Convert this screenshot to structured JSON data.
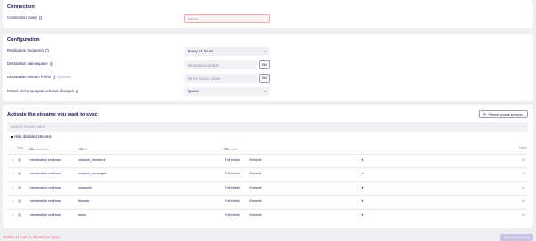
{
  "connection": {
    "section_title": "Connection",
    "name_label": "Connection name",
    "name_placeholder": "Name"
  },
  "configuration": {
    "section_title": "Configuration",
    "replication_label": "Replication frequency",
    "replication_value": "Every 24 hours",
    "namespace_label": "Destination Namespace",
    "namespace_value": "Destination default",
    "namespace_edit": "Edit",
    "prefix_label": "Destination Stream Prefix",
    "prefix_optional": "Optional",
    "prefix_placeholder": "Mirror source name",
    "prefix_edit": "Edit",
    "schema_changes_label": "Detect and propagate schema changes",
    "schema_changes_value": "Ignore"
  },
  "streams": {
    "section_title": "Activate the streams you want to sync",
    "refresh_label": "Refresh source schema",
    "search_placeholder": "Search stream name",
    "hide_disabled_label": "Hide disabled streams",
    "columns": {
      "sync": "Sync",
      "data_destination": "Data destination",
      "stream": "Stream",
      "sync_mode": "Sync mode",
      "fields": "Fields"
    },
    "rows": [
      {
        "destination": "<destination schema>",
        "stream": "channel_members",
        "sync_mode": "Full refresh",
        "overwrite": "Overwrite",
        "fields": "All"
      },
      {
        "destination": "<destination schema>",
        "stream": "channel_messages",
        "sync_mode": "Full refresh",
        "overwrite": "Overwrite",
        "fields": "All"
      },
      {
        "destination": "<destination schema>",
        "stream": "channels",
        "sync_mode": "Full refresh",
        "overwrite": "Overwrite",
        "fields": "All"
      },
      {
        "destination": "<destination schema>",
        "stream": "threads",
        "sync_mode": "Full refresh",
        "overwrite": "Overwrite",
        "fields": "All"
      },
      {
        "destination": "<destination schema>",
        "stream": "users",
        "sync_mode": "Full refresh",
        "overwrite": "Overwrite",
        "fields": "All"
      }
    ]
  },
  "footer": {
    "error": "Select at least 1 stream to sync.",
    "submit": "Set up connection"
  },
  "colors": {
    "error": "#ef4a6c",
    "primary_disabled": "#c7c5e3",
    "text": "#1a194d"
  }
}
